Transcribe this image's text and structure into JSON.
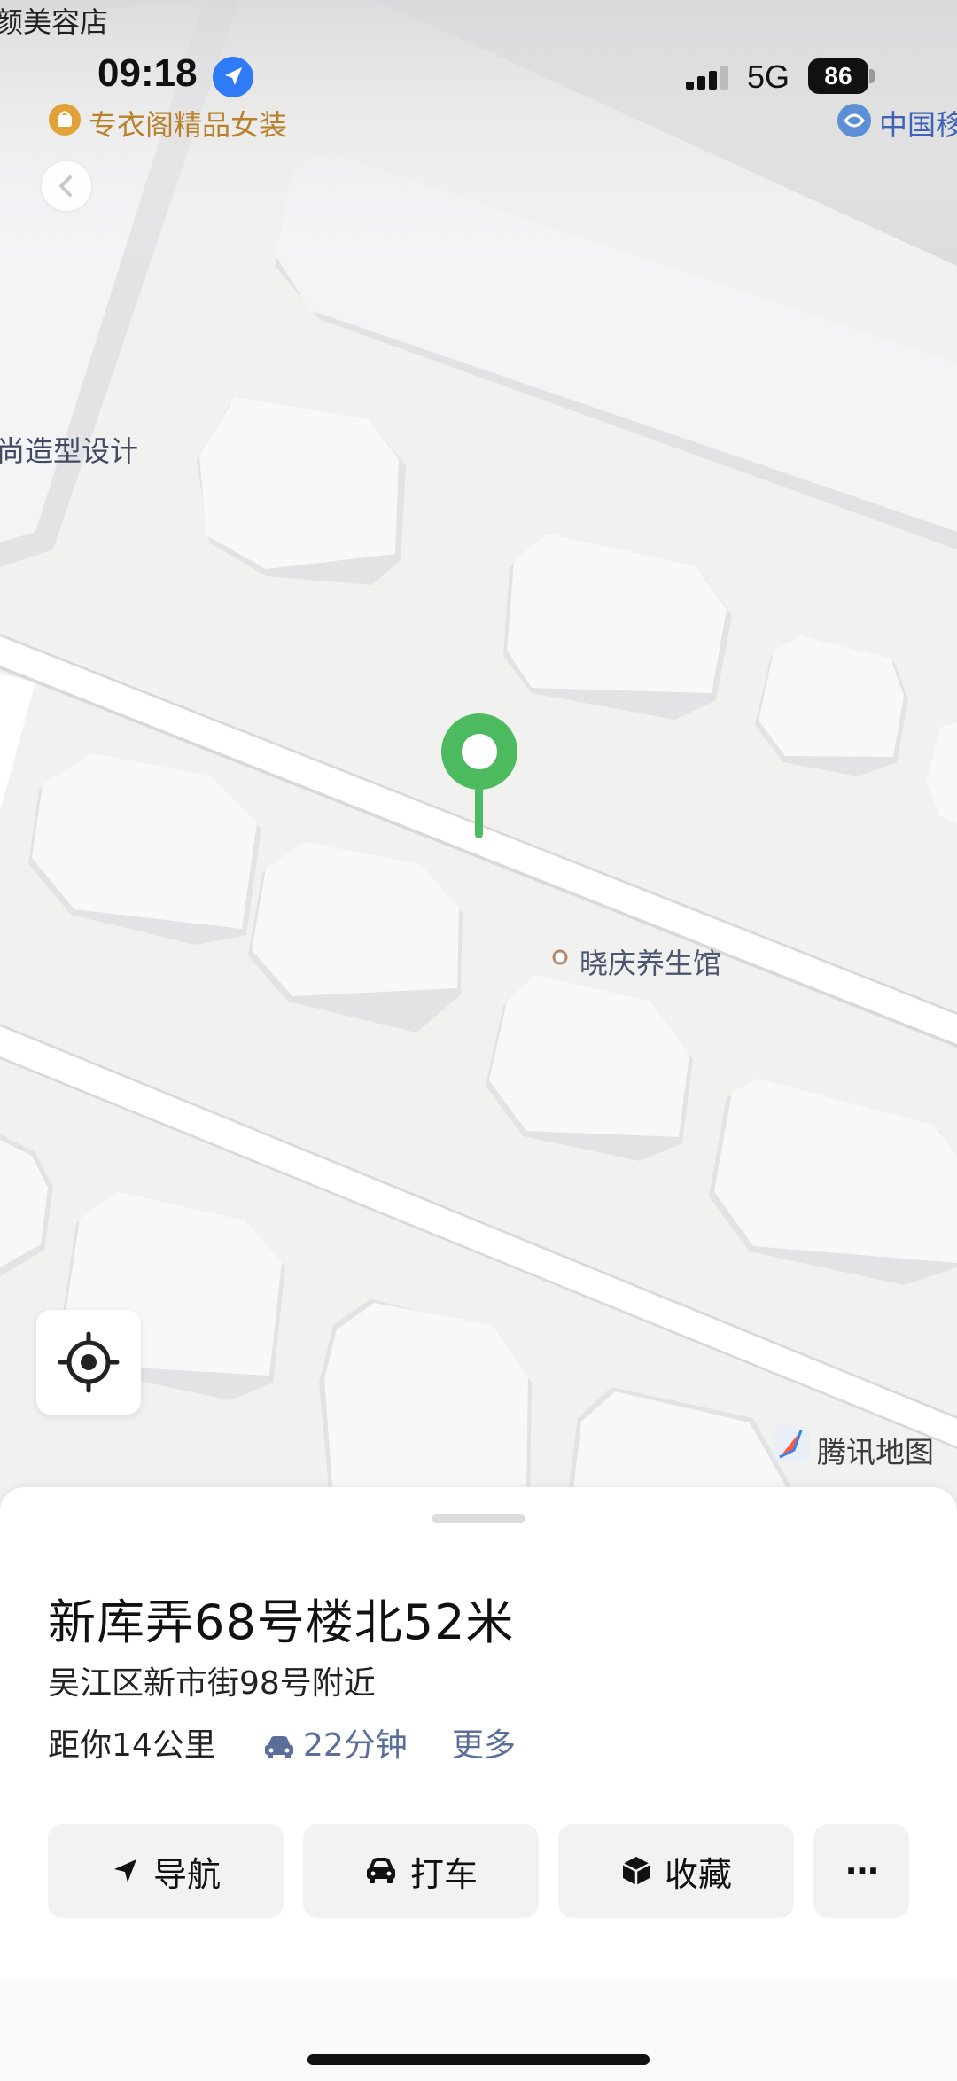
{
  "status_bar": {
    "time": "09:18",
    "network": "5G",
    "battery": "86",
    "app_back_label": "颜美容店"
  },
  "map": {
    "poi_labels": {
      "top_left": "专衣阁精品女装",
      "top_right": "中国移",
      "left_mid": "尚造型设计",
      "health": "晓庆养生馆"
    },
    "attribution": "腾讯地图",
    "pin_color": "#4cba5f",
    "road_color": "#ffffff",
    "block_color": "#f7f7f8",
    "ground_color": "#f1f1ef"
  },
  "sheet": {
    "title": "新库弄68号楼北52米",
    "address": "吴江区新市街98号附近",
    "distance": "距你14公里",
    "drive_time": "22分钟",
    "more": "更多",
    "buttons": {
      "navigate": "导航",
      "taxi": "打车",
      "favorite": "收藏",
      "more": "···"
    }
  }
}
